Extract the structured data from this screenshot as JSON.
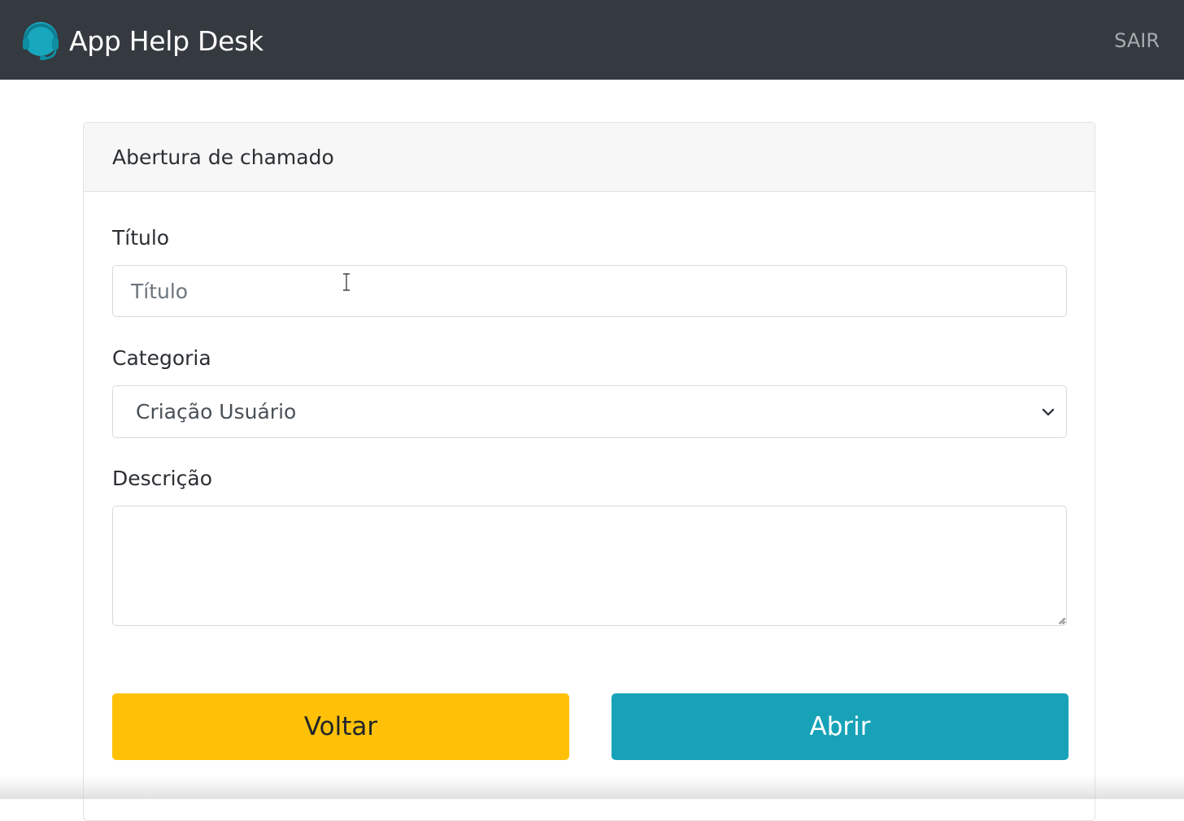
{
  "navbar": {
    "brand_title": "App Help Desk",
    "brand_icon": "headset-icon",
    "logout_label": "SAIR"
  },
  "card": {
    "header_title": "Abertura de chamado"
  },
  "form": {
    "title": {
      "label": "Título",
      "placeholder": "Título",
      "value": ""
    },
    "category": {
      "label": "Categoria",
      "selected": "Criação Usuário"
    },
    "description": {
      "label": "Descrição",
      "value": ""
    },
    "buttons": {
      "back_label": "Voltar",
      "open_label": "Abrir"
    }
  },
  "colors": {
    "navbar_bg": "#343a40",
    "brand_accent": "#17a2b8",
    "back_button": "#ffc107",
    "open_button": "#17a2b8"
  }
}
